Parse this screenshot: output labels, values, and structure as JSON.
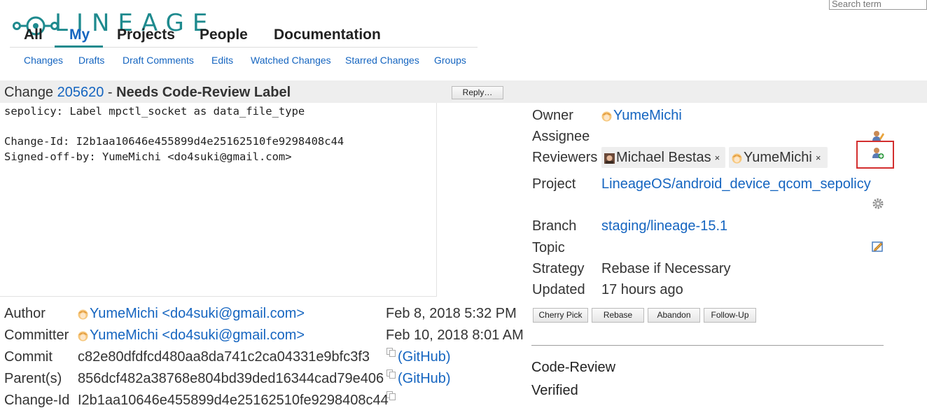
{
  "brand": {
    "logo_text": "LINEAGE",
    "teal": "#1e8a8e",
    "link_blue": "#1565c0"
  },
  "search": {
    "placeholder": "Search term",
    "value": ""
  },
  "top_menu": {
    "items": [
      "All",
      "My",
      "Projects",
      "People",
      "Documentation"
    ],
    "active": "My"
  },
  "sub_menu": [
    "Changes",
    "Drafts",
    "Draft Comments",
    "Edits",
    "Watched Changes",
    "Starred Changes",
    "Groups"
  ],
  "change": {
    "prefix": "Change",
    "number": "205620",
    "separator": " - ",
    "status": "Needs Code-Review Label",
    "reply_label": "Reply…"
  },
  "commit_message": {
    "subject": "sepolicy: Label mpctl_socket as data_file_type",
    "change_id_line": "Change-Id: I2b1aa10646e455899d4e25162510fe9298408c44",
    "signed_off_line": "Signed-off-by: YumeMichi <do4suki@gmail.com>"
  },
  "info": {
    "owner_label": "Owner",
    "owner": "YumeMichi",
    "assignee_label": "Assignee",
    "reviewers_label": "Reviewers",
    "reviewers": [
      {
        "name": "Michael Bestas",
        "remove": "×"
      },
      {
        "name": "YumeMichi",
        "remove": "×"
      }
    ],
    "project_label": "Project",
    "project": "LineageOS/android_device_qcom_sepolicy",
    "branch_label": "Branch",
    "branch": "staging/lineage-15.1",
    "topic_label": "Topic",
    "strategy_label": "Strategy",
    "strategy": "Rebase if Necessary",
    "updated_label": "Updated",
    "updated": "17 hours ago",
    "icons": [
      "edit-assignee-icon",
      "add-reviewer-icon",
      "settings-gear-icon",
      "edit-topic-icon"
    ]
  },
  "actions": [
    "Cherry Pick",
    "Rebase",
    "Abandon",
    "Follow-Up"
  ],
  "labels": [
    "Code-Review",
    "Verified"
  ],
  "commit_info": {
    "author_label": "Author",
    "author": "YumeMichi <do4suki@gmail.com>",
    "author_date": "Feb 8, 2018 5:32 PM",
    "committer_label": "Committer",
    "committer": "YumeMichi <do4suki@gmail.com>",
    "committer_date": "Feb 10, 2018 8:01 AM",
    "commit_label": "Commit",
    "commit": "c82e80dfdfcd480aa8da741c2ca04331e9bfc3f3",
    "commit_link": "(GitHub)",
    "parents_label": "Parent(s)",
    "parent": "856dcf482a38768e804bd39ded16344cad79e406",
    "parent_link": "(GitHub)",
    "change_id_label": "Change-Id",
    "change_id": "I2b1aa10646e455899d4e25162510fe9298408c44"
  }
}
